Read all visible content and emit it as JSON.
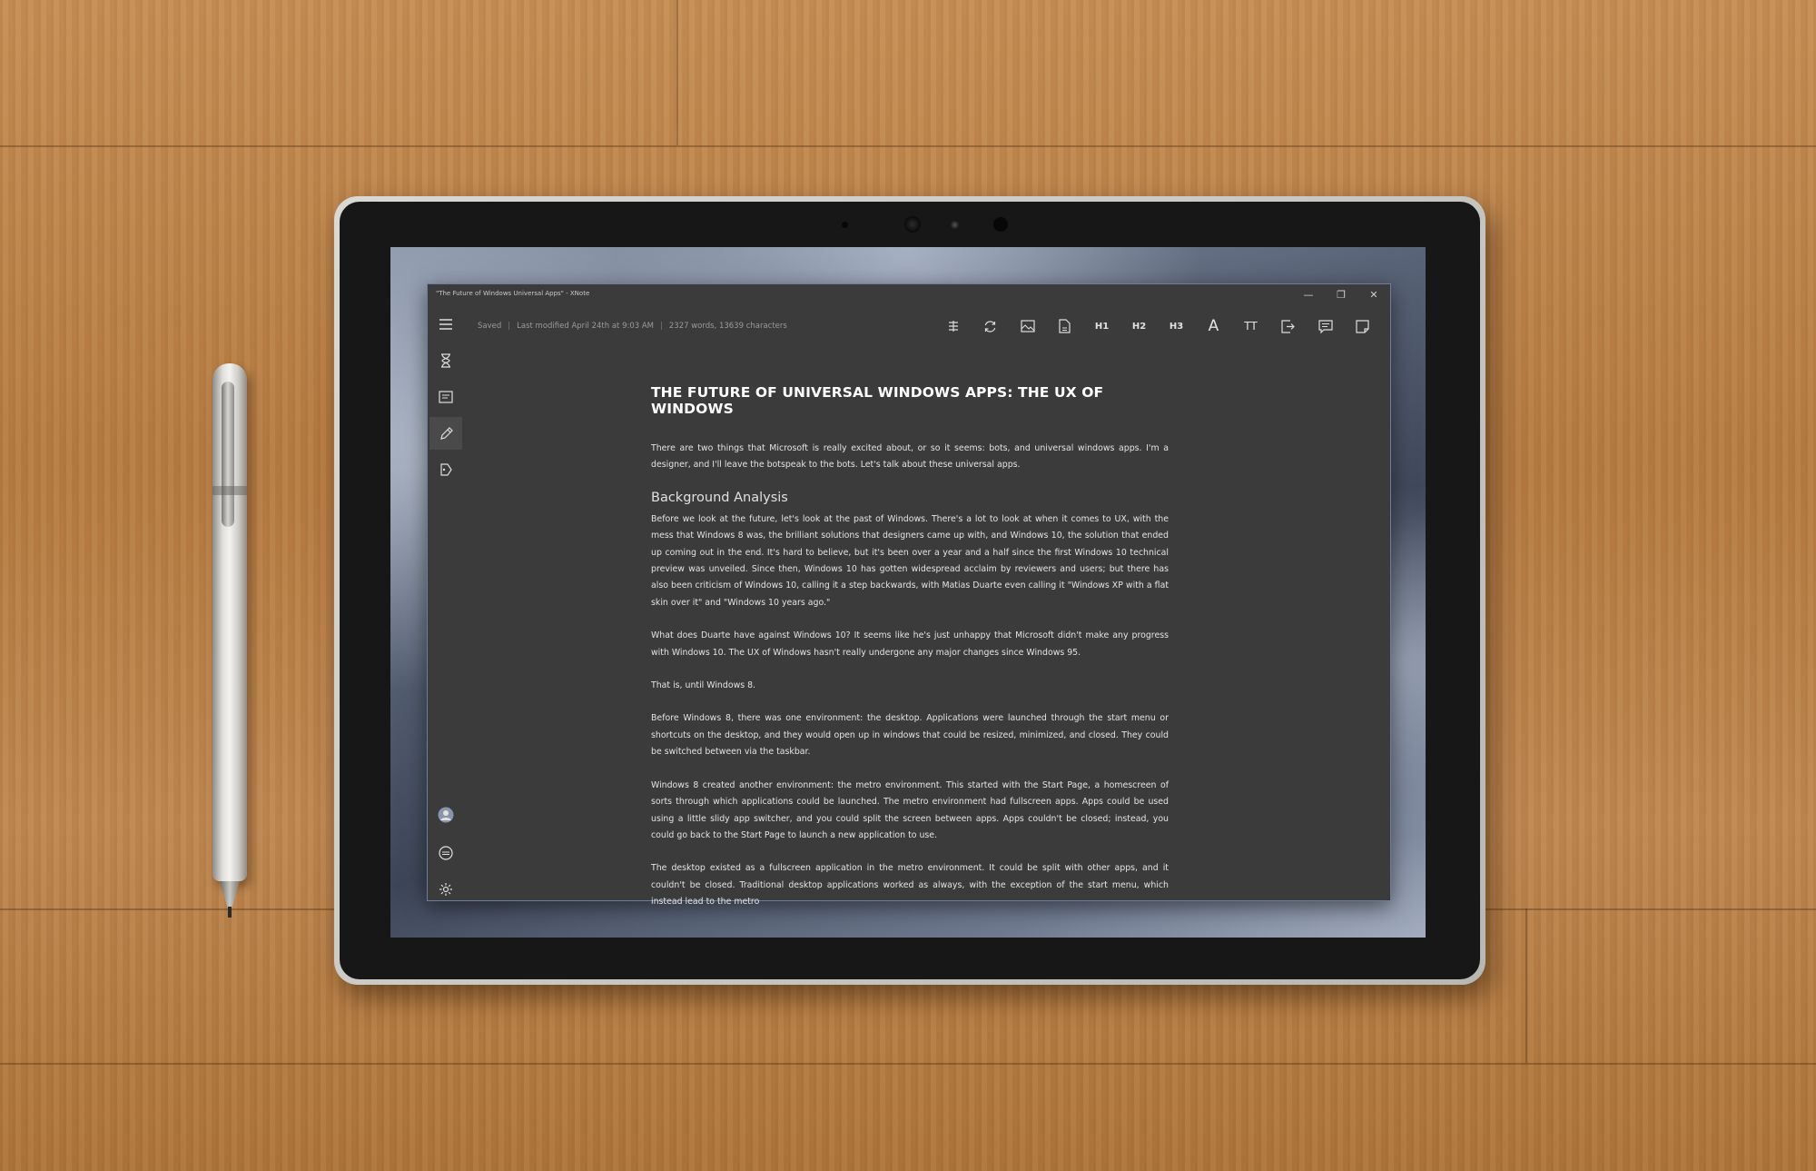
{
  "window": {
    "title": "\"The Future of Windows Universal Apps\" - XNote",
    "controls": {
      "minimize": "—",
      "restore": "❐",
      "close": "✕"
    }
  },
  "status": {
    "saved": "Saved",
    "modified": "Last modified April 24th at 9:03 AM",
    "counts": "2327 words, 13639 characters"
  },
  "toolbar": {
    "items": [
      {
        "id": "strikethrough",
        "icon": "strikethrough-icon"
      },
      {
        "id": "sync",
        "icon": "sync-icon"
      },
      {
        "id": "image",
        "icon": "image-icon"
      },
      {
        "id": "page",
        "icon": "page-icon"
      },
      {
        "id": "heading1",
        "label": "H1"
      },
      {
        "id": "heading2",
        "label": "H2"
      },
      {
        "id": "heading3",
        "label": "H3"
      },
      {
        "id": "font",
        "label": "A"
      },
      {
        "id": "font-size",
        "label": "TT"
      },
      {
        "id": "export",
        "icon": "export-icon"
      },
      {
        "id": "comment",
        "icon": "comment-icon"
      },
      {
        "id": "note",
        "icon": "sticky-note-icon"
      }
    ]
  },
  "sidebar": {
    "top": [
      {
        "icon": "hamburger-menu-icon",
        "active": false
      },
      {
        "icon": "hourglass-icon",
        "active": false
      },
      {
        "icon": "document-list-icon",
        "active": false
      },
      {
        "icon": "pen-icon",
        "active": true
      },
      {
        "icon": "tag-icon",
        "active": false
      }
    ],
    "bottom": [
      {
        "icon": "avatar-icon"
      },
      {
        "icon": "storage-icon"
      },
      {
        "icon": "gear-icon"
      }
    ]
  },
  "document": {
    "title": "THE FUTURE OF UNIVERSAL WINDOWS APPS:  THE UX OF WINDOWS",
    "intro": "There are two things that Microsoft is really excited about, or so it seems: bots, and universal windows apps. I'm a designer, and I'll leave the botspeak to the bots. Let's talk about these universal apps.",
    "section_heading": "Background Analysis",
    "paragraphs": [
      "Before we look at the future, let's look at the past of Windows. There's a lot to look at when it comes to UX, with the mess that Windows 8 was, the brilliant solutions that designers came up with, and Windows 10, the solution that ended up coming out in the end. It's hard to believe, but it's been over a year and a half since the first Windows 10 technical preview was unveiled. Since then, Windows 10 has gotten widespread acclaim by reviewers and users; but there has also been criticism of Windows 10, calling it a step backwards, with Matias Duarte even calling it \"Windows XP with a flat skin over it\" and \"Windows 10 years ago.\"",
      "What does Duarte have against Windows 10? It seems like he's just unhappy that Microsoft didn't make any progress with Windows 10. The UX of Windows hasn't really undergone any major changes since Windows 95.",
      "That is, until Windows 8.",
      "Before Windows 8, there was one environment: the desktop. Applications were launched through the start menu or shortcuts on the desktop, and they would open up in windows that could be resized, minimized, and closed. They could be switched between via the taskbar.",
      "Windows 8 created another environment: the metro environment. This started with the Start Page, a homescreen of sorts through which applications could be launched. The metro environment had fullscreen apps. Apps could be used using a little slidy app switcher, and you could split the screen between apps. Apps couldn't be closed; instead, you could go back to the Start Page to launch a new application to use.",
      "The desktop existed as a fullscreen application in the metro environment. It could be split with other apps, and it couldn't be closed. Traditional desktop applications worked as always, with the exception of the start menu, which instead lead to the metro"
    ]
  },
  "colors": {
    "app_background": "#3b3b3b",
    "window_border": "#6f7e9c",
    "text": "#e3e3e3",
    "status_text": "#9a9a9a"
  }
}
